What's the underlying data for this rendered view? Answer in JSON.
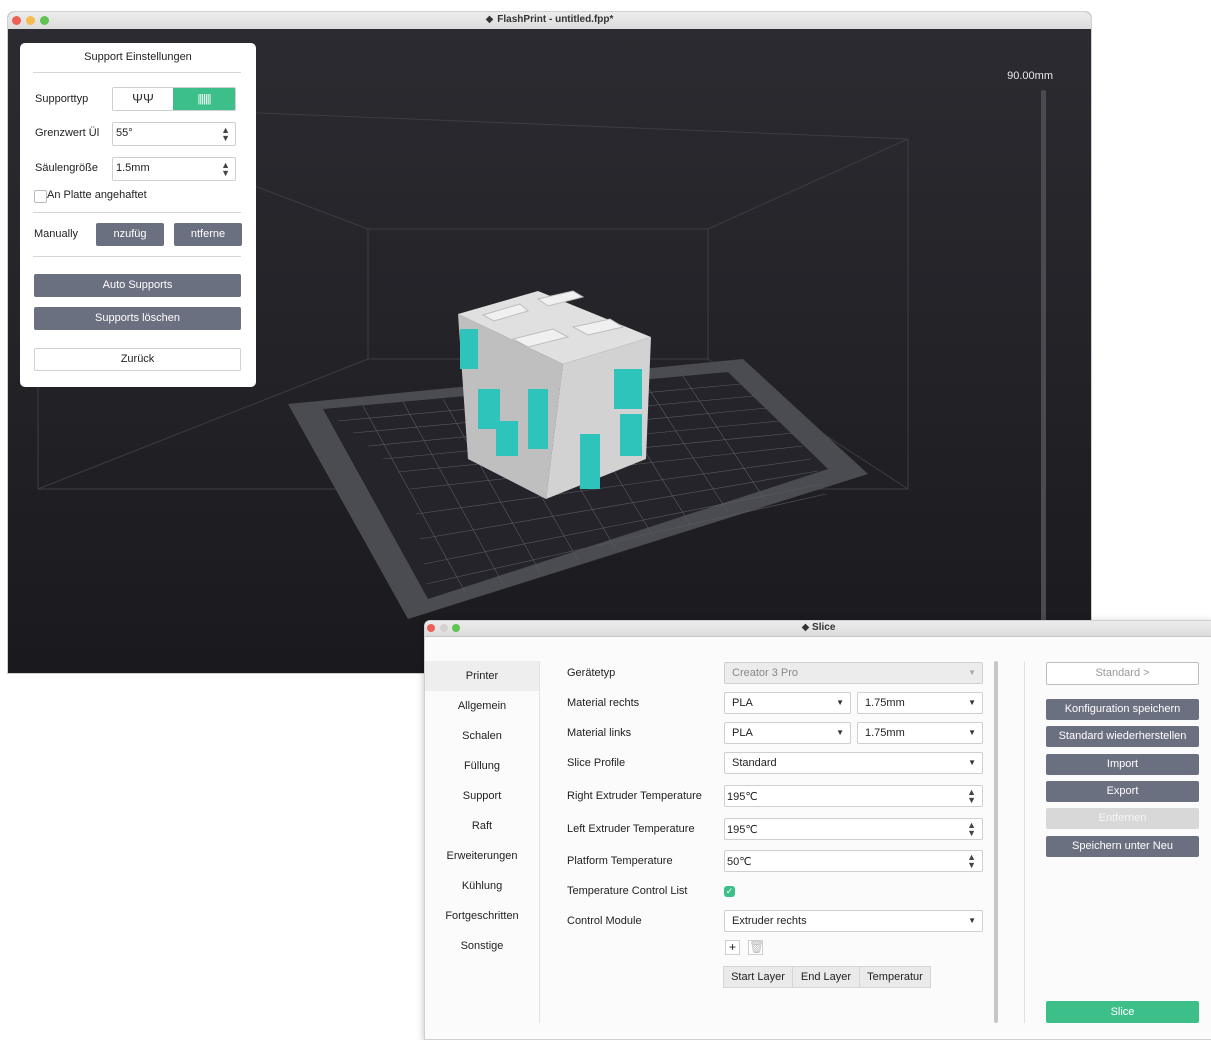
{
  "main_window": {
    "title": "FlashPrint - untitled.fpp*",
    "height_label": "90.00mm"
  },
  "support_panel": {
    "title": "Support Einstellungen",
    "support_type_label": "Supporttyp",
    "threshold_label": "Grenzwert Ül",
    "threshold_value": "55°",
    "pillar_size_label": "Säulengröße",
    "pillar_size_value": "1.5mm",
    "attached_label": "An Platte angehaftet",
    "manually_label": "Manually",
    "add_label": "nzufüg",
    "remove_label": "ntferne",
    "auto_supports": "Auto Supports",
    "clear_supports": "Supports löschen",
    "back": "Zurück"
  },
  "slice_window": {
    "title": "Slice",
    "nav": [
      "Printer",
      "Allgemein",
      "Schalen",
      "Füllung",
      "Support",
      "Raft",
      "Erweiterungen",
      "Kühlung",
      "Fortgeschritten",
      "Sonstige"
    ],
    "form": {
      "device_type_label": "Gerätetyp",
      "device_type_value": "Creator 3 Pro",
      "material_right_label": "Material rechts",
      "material_right_value": "PLA",
      "material_right_diameter": "1.75mm",
      "material_left_label": "Material links",
      "material_left_value": "PLA",
      "material_left_diameter": "1.75mm",
      "slice_profile_label": "Slice Profile",
      "slice_profile_value": "Standard",
      "right_temp_label": "Right Extruder Temperature",
      "right_temp_value": "195℃",
      "left_temp_label": "Left Extruder Temperature",
      "left_temp_value": "195℃",
      "platform_temp_label": "Platform Temperature",
      "platform_temp_value": "50℃",
      "temp_control_label": "Temperature Control List",
      "control_module_label": "Control Module",
      "control_module_value": "Extruder rechts",
      "table_headers": [
        "Start Layer",
        "End Layer",
        "Temperatur"
      ]
    },
    "right_buttons": {
      "standard": "Standard >",
      "save_config": "Konfiguration speichern",
      "restore_default": "Standard wiederherstellen",
      "import": "Import",
      "export": "Export",
      "remove": "Entfernen",
      "save_as_new": "Speichern unter Neu",
      "slice": "Slice"
    }
  },
  "colors": {
    "accent": "#3dbf8a",
    "button": "#6b7080",
    "viewport": "#1e1e22",
    "support": "#2ec4bc",
    "model": "#c9c9c9"
  }
}
